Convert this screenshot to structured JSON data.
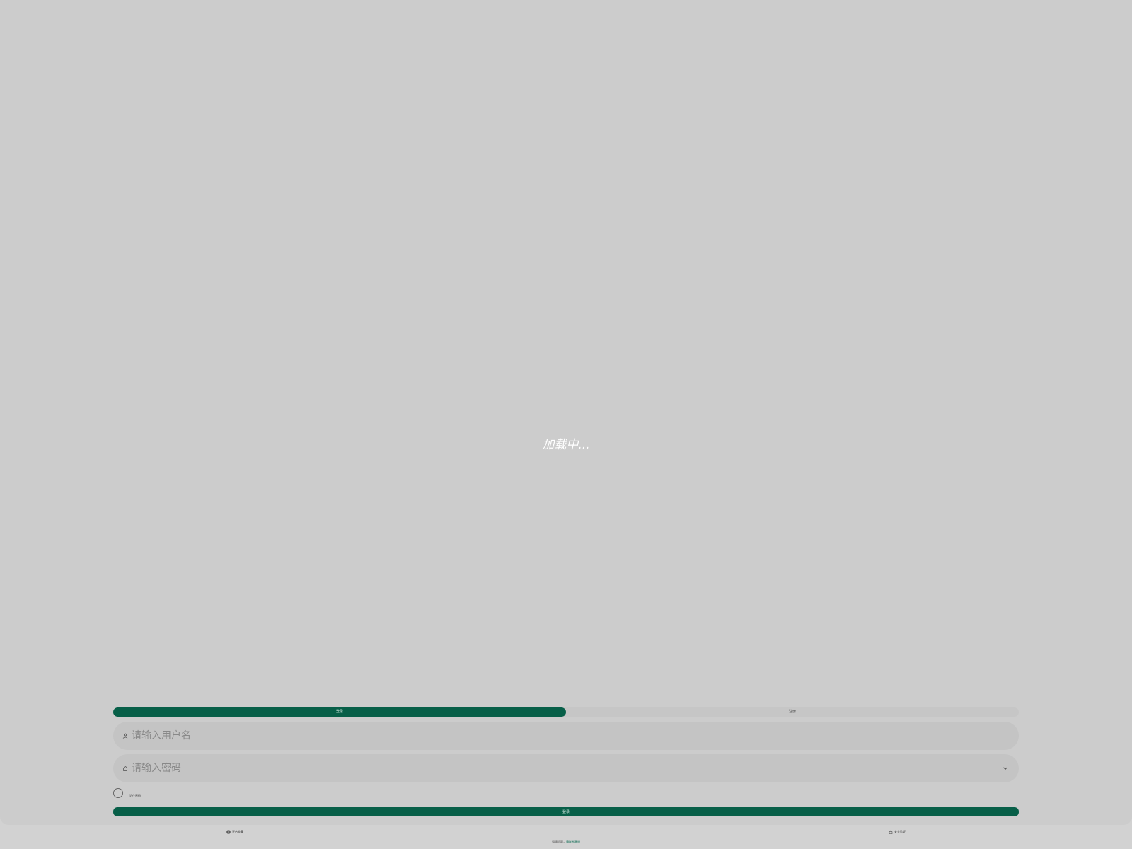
{
  "loading": {
    "text": "加载中..."
  },
  "tabs": [
    {
      "label": "登录",
      "active": true
    },
    {
      "label": "注册",
      "active": false
    }
  ],
  "form": {
    "username_placeholder": "请输入用户名",
    "password_placeholder": "请输入密码",
    "remember_label": "记住密码",
    "submit_label": "登录"
  },
  "footer": {
    "left_label": "开启收藏",
    "right_label": "安全验证",
    "note_prefix": "如遇问题，",
    "note_link": "请联系客服"
  },
  "colors": {
    "accent": "#075f48",
    "panel": "#cccccc",
    "input": "#c4c4c4"
  },
  "icons": {
    "username": "user-icon",
    "password": "lock-icon",
    "dropdown": "chevron-down-icon",
    "footer_left": "globe-icon",
    "footer_right": "lock-icon"
  }
}
